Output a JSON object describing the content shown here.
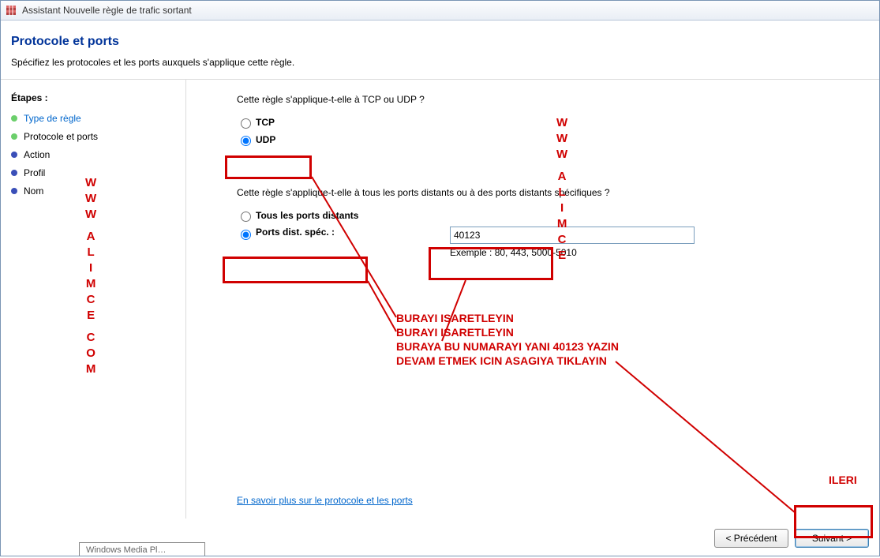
{
  "window": {
    "title": "Assistant Nouvelle règle de trafic sortant"
  },
  "header": {
    "title": "Protocole et ports",
    "subtitle": "Spécifiez les protocoles et les ports auxquels s'applique cette règle."
  },
  "sidebar": {
    "steps_label": "Étapes :",
    "items": [
      {
        "label": "Type de règle",
        "state": "done"
      },
      {
        "label": "Protocole et ports",
        "state": "current"
      },
      {
        "label": "Action",
        "state": "future"
      },
      {
        "label": "Profil",
        "state": "future"
      },
      {
        "label": "Nom",
        "state": "future"
      }
    ]
  },
  "content": {
    "q1": "Cette règle s'applique-t-elle à TCP ou UDP ?",
    "tcp_label": "TCP",
    "udp_label": "UDP",
    "q2": "Cette règle s'applique-t-elle à tous les ports distants ou à des ports distants spécifiques ?",
    "all_ports_label": "Tous les ports distants",
    "specific_ports_label": "Ports dist. spéc. :",
    "port_value": "40123",
    "example": "Exemple : 80, 443, 5000-5010",
    "learn_more": "En savoir plus sur le protocole et les ports"
  },
  "footer": {
    "back": "< Précédent",
    "next": "Suivant >"
  },
  "annotations": {
    "line1": "BURAYI ISARETLEYIN",
    "line2": "BURAYI ISARETLEYIN",
    "line3": "BURAYA BU NUMARAYI YANI 40123 YAZIN",
    "line4": "DEVAM ETMEK ICIN ASAGIYA TIKLAYIN",
    "ileri": "ILERI",
    "vertical_brand": "WWW ALIMCE COM"
  },
  "taskbar_stub": "Windows Media Pl…"
}
